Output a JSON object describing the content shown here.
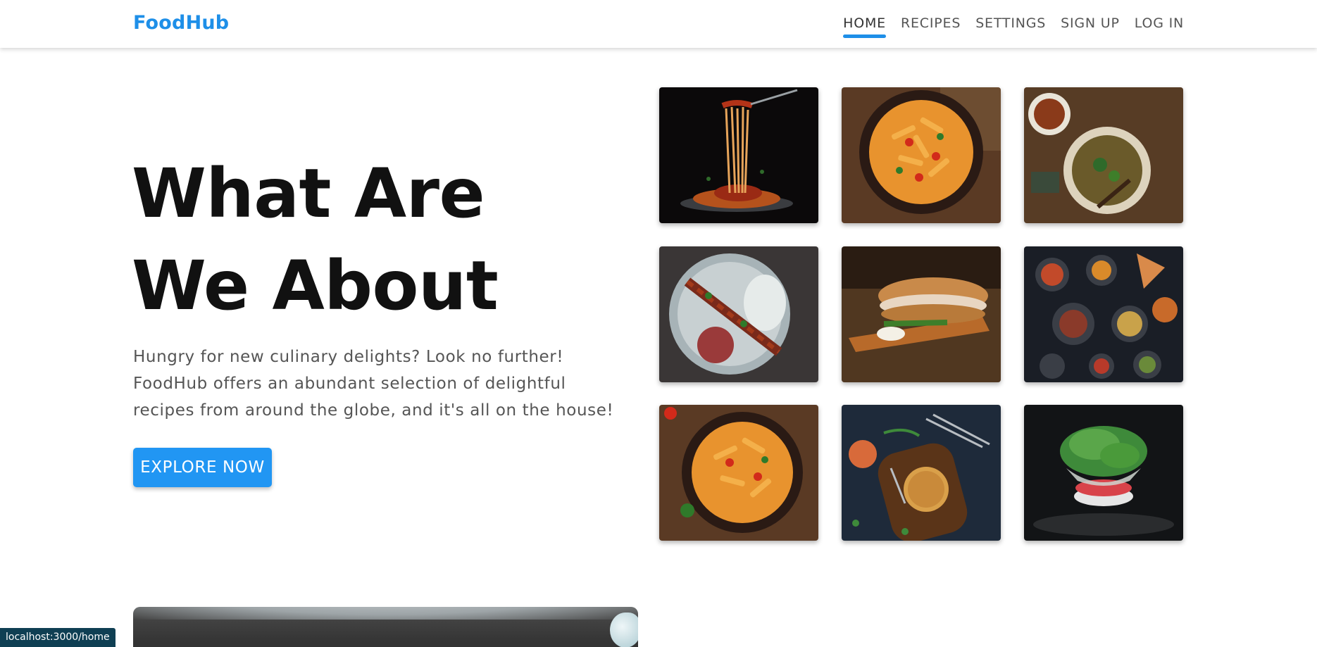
{
  "brand": {
    "name": "FoodHub"
  },
  "nav": {
    "items": [
      {
        "label": "HOME",
        "active": true
      },
      {
        "label": "RECIPES",
        "active": false
      },
      {
        "label": "SETTINGS",
        "active": false
      },
      {
        "label": "SIGN UP",
        "active": false
      },
      {
        "label": "LOG IN",
        "active": false
      }
    ]
  },
  "hero": {
    "title": "What Are We About",
    "description": "Hungry for new culinary delights? Look no further! FoodHub offers an abundant selection of delightful recipes from around the globe, and it's all on the house!",
    "cta_label": "EXPLORE NOW"
  },
  "gallery": {
    "images": [
      "spaghetti-fork-image",
      "penne-bowl-image",
      "soup-bowl-image",
      "kebab-plate-image",
      "sandwich-board-image",
      "mezze-spread-image",
      "penne-bowl-image",
      "burger-board-image",
      "salad-bowl-image"
    ]
  },
  "status_bar": {
    "url": "localhost:3000/home"
  },
  "colors": {
    "accent": "#1e8fe8",
    "button": "#2196f3",
    "status_bg": "#0f3f53"
  }
}
